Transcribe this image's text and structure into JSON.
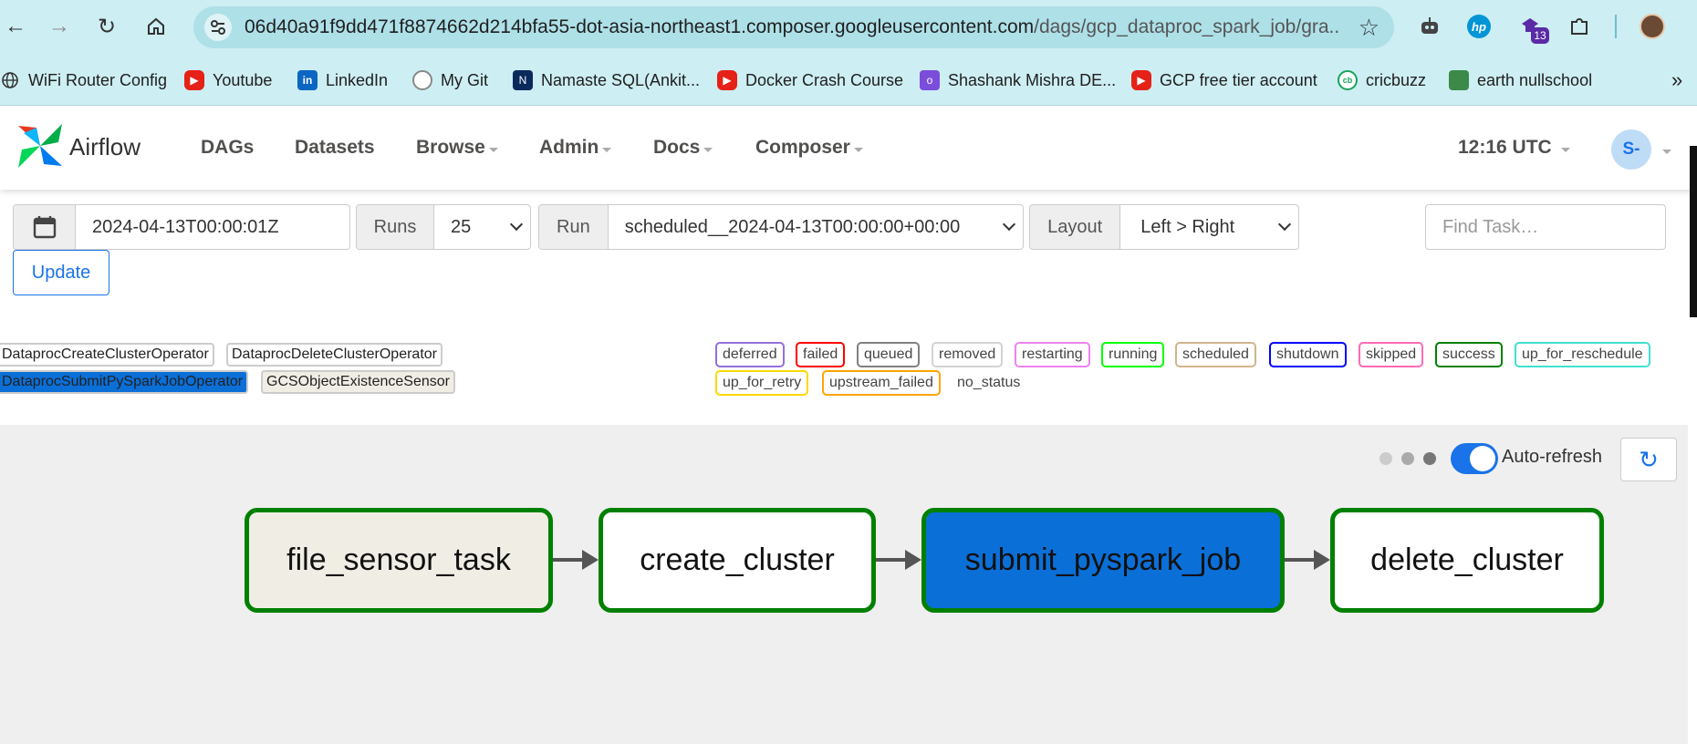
{
  "browser": {
    "url_main": "06d40a91f9dd471f8874662d214bfa55-dot-asia-northeast1.composer.googleusercontent.com",
    "url_path": "/dags/gcp_dataproc_spark_job/gra...",
    "extension_badge": "13",
    "bookmarks": [
      {
        "label": "WiFi Router Config",
        "icon": "globe-icon"
      },
      {
        "label": "Youtube",
        "icon": "youtube-icon"
      },
      {
        "label": "LinkedIn",
        "icon": "linkedin-icon"
      },
      {
        "label": "My Git",
        "icon": "github-icon"
      },
      {
        "label": "Namaste SQL(Ankit...",
        "icon": "site-icon"
      },
      {
        "label": "Docker Crash Course",
        "icon": "youtube-icon"
      },
      {
        "label": "Shashank Mishra DE...",
        "icon": "site-icon"
      },
      {
        "label": "GCP free tier account",
        "icon": "youtube-icon"
      },
      {
        "label": "cricbuzz",
        "icon": "cricbuzz-icon"
      },
      {
        "label": "earth nullschool",
        "icon": "site-icon"
      }
    ]
  },
  "header": {
    "brand": "Airflow",
    "nav": [
      "DAGs",
      "Datasets",
      "Browse",
      "Admin",
      "Docs",
      "Composer"
    ],
    "time": "12:16 UTC",
    "avatar": "S-"
  },
  "toolbar": {
    "date_value": "2024-04-13T00:00:01Z",
    "runs_label": "Runs",
    "runs_value": "25",
    "run_label": "Run",
    "run_value": "scheduled__2024-04-13T00:00:00+00:00",
    "layout_label": "Layout",
    "layout_value": "Left > Right",
    "find_placeholder": "Find Task…",
    "update_label": "Update"
  },
  "operators": [
    {
      "label": "DataprocCreateClusterOperator"
    },
    {
      "label": "DataprocDeleteClusterOperator"
    },
    {
      "label": "DataprocSubmitPySparkJobOperator"
    },
    {
      "label": "GCSObjectExistenceSensor"
    }
  ],
  "statuses": [
    {
      "label": "deferred",
      "color": "#9370db"
    },
    {
      "label": "failed",
      "color": "#ff0000"
    },
    {
      "label": "queued",
      "color": "#808080"
    },
    {
      "label": "removed",
      "color": "#d3d3d3"
    },
    {
      "label": "restarting",
      "color": "#ee82ee"
    },
    {
      "label": "running",
      "color": "#00ff00"
    },
    {
      "label": "scheduled",
      "color": "#d2b48c"
    },
    {
      "label": "shutdown",
      "color": "#0000ff"
    },
    {
      "label": "skipped",
      "color": "#ff69b4"
    },
    {
      "label": "success",
      "color": "#008000"
    },
    {
      "label": "up_for_reschedule",
      "color": "#40e0d0"
    },
    {
      "label": "up_for_retry",
      "color": "#ffd700"
    },
    {
      "label": "upstream_failed",
      "color": "#ffa500"
    },
    {
      "label": "no_status",
      "color": ""
    }
  ],
  "graph": {
    "auto_refresh_label": "Auto-refresh",
    "tasks": [
      {
        "label": "file_sensor_task",
        "fill": "#f0eee4",
        "text_color": "#111"
      },
      {
        "label": "create_cluster",
        "fill": "#ffffff",
        "text_color": "#111"
      },
      {
        "label": "submit_pyspark_job",
        "fill": "#0b6fd8",
        "text_color": "#111"
      },
      {
        "label": "delete_cluster",
        "fill": "#ffffff",
        "text_color": "#111"
      }
    ]
  }
}
